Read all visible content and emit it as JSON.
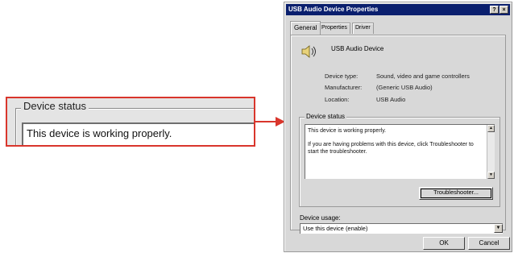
{
  "zoom": {
    "legend": "Device status",
    "status_text": "This device is working properly."
  },
  "dialog": {
    "title": "USB Audio Device Properties",
    "title_buttons": {
      "help": "?",
      "close": "×"
    },
    "tabs": [
      {
        "label": "General",
        "active": true
      },
      {
        "label": "Properties",
        "active": false
      },
      {
        "label": "Driver",
        "active": false
      }
    ],
    "device_name": "USB Audio Device",
    "properties": [
      {
        "label": "Device type:",
        "value": "Sound, video and game controllers"
      },
      {
        "label": "Manufacturer:",
        "value": "(Generic USB Audio)"
      },
      {
        "label": "Location:",
        "value": "USB Audio"
      }
    ],
    "status": {
      "legend": "Device status",
      "line1": "This device is working properly.",
      "line2": "If you are having problems with this device, click Troubleshooter to start the troubleshooter."
    },
    "troubleshooter_label": "Troubleshooter...",
    "usage": {
      "label": "Device usage:",
      "selected": "Use this device (enable)"
    },
    "ok_label": "OK",
    "cancel_label": "Cancel"
  },
  "colors": {
    "callout_red": "#d9362c",
    "titlebar": "#0a1f6e",
    "dialog_bg": "#d8d8d8"
  },
  "icons": [
    "speaker-icon",
    "arrow-icon",
    "help-icon",
    "close-icon",
    "scroll-up-icon",
    "scroll-down-icon",
    "dropdown-arrow-icon"
  ]
}
